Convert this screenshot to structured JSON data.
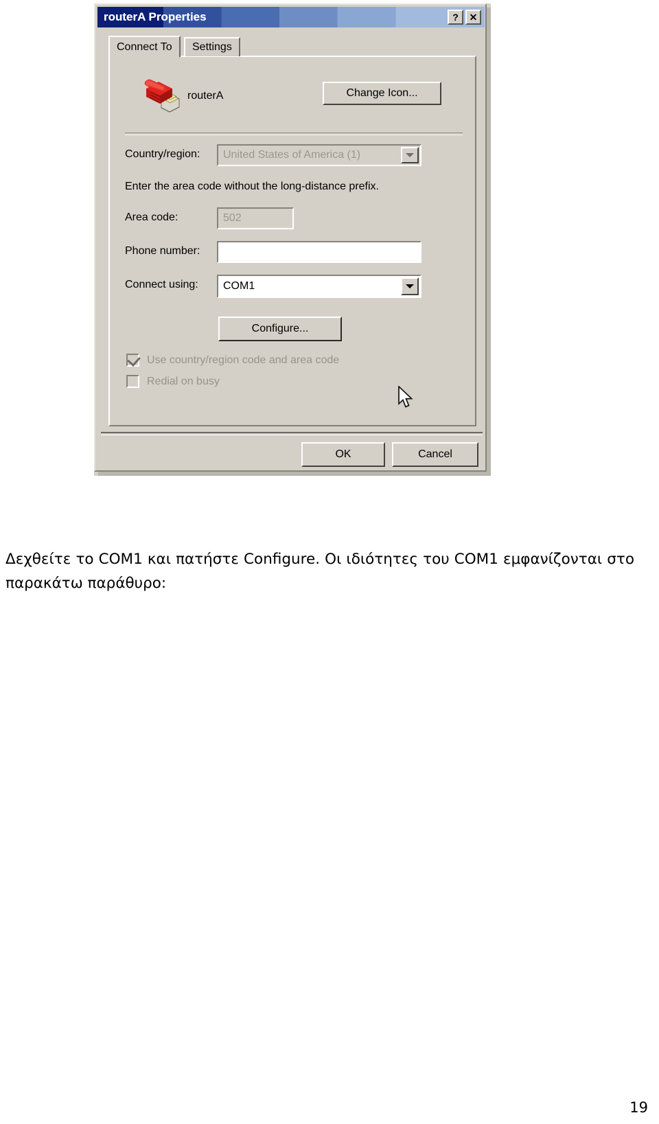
{
  "document": {
    "paragraph": "Δεχθείτε το COM1 και πατήστε Configure. Οι ιδιότητες του COM1 εμφανίζονται στο παρακάτω παράθυρο:",
    "page_number": "19"
  },
  "dialog": {
    "title": "routerA Properties",
    "titlebar_buttons": {
      "help": "?",
      "close": "✕"
    },
    "tabs": [
      {
        "label": "Connect To",
        "active": true
      },
      {
        "label": "Settings",
        "active": false
      }
    ],
    "identity": {
      "name": "routerA",
      "change_icon_label": "Change Icon..."
    },
    "fields": {
      "country_label": "Country/region:",
      "country_value": "United States of America (1)",
      "country_enabled": false,
      "hint": "Enter the area code without the long-distance prefix.",
      "area_code_label": "Area code:",
      "area_code_value": "502",
      "area_code_enabled": false,
      "phone_number_label": "Phone number:",
      "phone_number_value": "",
      "connect_using_label": "Connect using:",
      "connect_using_value": "COM1",
      "connect_using_enabled": true
    },
    "configure_label": "Configure...",
    "checkboxes": [
      {
        "label": "Use country/region code and area code",
        "checked": true,
        "enabled": false
      },
      {
        "label": "Redial on busy",
        "checked": false,
        "enabled": false
      }
    ],
    "footer": {
      "ok_label": "OK",
      "cancel_label": "Cancel"
    },
    "colors": {
      "face": "#d4d0c8",
      "title_start": "#0a1e74",
      "title_end": "#a2bade",
      "disabled_text": "#96938b"
    }
  }
}
